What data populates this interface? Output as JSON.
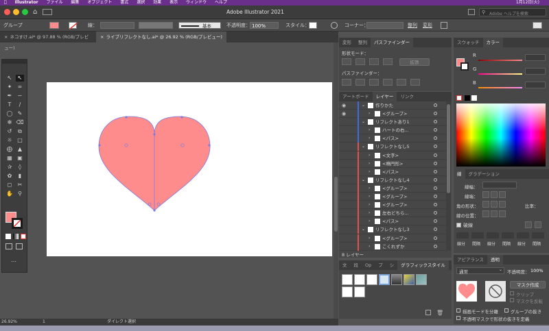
{
  "menubar": {
    "items": [
      "Illustrator",
      "ファイル",
      "編集",
      "オブジェクト",
      "書式",
      "選択",
      "効果",
      "表示",
      "ウィンドウ",
      "ヘルプ"
    ],
    "datetime": "1月12日(火)"
  },
  "app": {
    "title": "Adobe Illustrator 2021",
    "search_placeholder": "Adobe ヘルプを検索"
  },
  "control_bar": {
    "selection_label": "グループ",
    "stroke_label": "線：",
    "stroke_style": "基本",
    "opacity_label": "不透明度：",
    "opacity_value": "100%",
    "style_label": "スタイル：",
    "corner_label": "コーナー：",
    "align_label": "整列",
    "transform_label": "変形"
  },
  "doc_tabs": [
    {
      "label": "ネコすけ.ai* @ 97.88 % (RGB/プレビュー)",
      "active": false
    },
    {
      "label": "ライブリフレクトなし.ai* @ 26.92 % (RGB/プレビュー)",
      "active": true
    }
  ],
  "colors": {
    "heart_fill": "#FF8C8C",
    "path_stroke": "#7B79E0",
    "menubar": "#6a2f8a",
    "accent_blue": "#1f6fd0"
  },
  "pathfinder": {
    "tabs": [
      "変形",
      "整列",
      "パスファインダー"
    ],
    "shape_modes_label": "形状モード：",
    "expand_label": "拡張",
    "pathfinders_label": "パスファインダー："
  },
  "layers": {
    "tabs": [
      "アートボード",
      "レイヤー",
      "リンク"
    ],
    "rows": [
      {
        "label": "作りかた",
        "level": 0,
        "visible": true
      },
      {
        "label": "<グループ>",
        "level": 1,
        "visible": true
      },
      {
        "label": "リフレクトあり1",
        "level": 0,
        "visible": false
      },
      {
        "label": "ハートの右...",
        "level": 1,
        "visible": false
      },
      {
        "label": "<パス>",
        "level": 1,
        "visible": false
      },
      {
        "label": "リフレクトなし5",
        "level": 0,
        "visible": false
      },
      {
        "label": "<文字>",
        "level": 1,
        "visible": false
      },
      {
        "label": "<楕円形>",
        "level": 1,
        "visible": false
      },
      {
        "label": "<パス>",
        "level": 1,
        "visible": false
      },
      {
        "label": "リフレクトなし4",
        "level": 0,
        "visible": false
      },
      {
        "label": "<グループ>",
        "level": 1,
        "visible": false
      },
      {
        "label": "<グループ>",
        "level": 1,
        "visible": false
      },
      {
        "label": "<グループ>",
        "level": 1,
        "visible": false
      },
      {
        "label": "左右どちら...",
        "level": 1,
        "visible": false
      },
      {
        "label": "<パス>",
        "level": 1,
        "visible": false
      },
      {
        "label": "リフレクトなし3",
        "level": 0,
        "visible": false
      },
      {
        "label": "<グループ>",
        "level": 1,
        "visible": false
      },
      {
        "label": "こくれずか",
        "level": 1,
        "visible": false
      }
    ],
    "count_label": "8 レイヤー"
  },
  "graphic_styles": {
    "tabs": [
      "文",
      "段",
      "Op",
      "プ",
      "シ",
      "グラフィックスタイル"
    ]
  },
  "swatches": {
    "tabs": [
      "スウォッチ",
      "カラー"
    ],
    "channels": [
      "R",
      "G",
      "B"
    ]
  },
  "stroke_panel": {
    "tabs": [
      "線",
      "グラデーション"
    ],
    "width_label": "線幅：",
    "cap_label": "線端：",
    "corner_label": "角の形状：",
    "limit_label": "比率：",
    "align_label": "線の位置：",
    "dashed_label": "破線",
    "dash_cells": [
      "線分",
      "間隔",
      "線分",
      "間隔",
      "線分",
      "間隔"
    ]
  },
  "transparency": {
    "tabs": [
      "アピアランス",
      "透明"
    ],
    "blend_mode": "通常",
    "opacity_label": "不透明度：",
    "opacity_value": "100%",
    "mask_button": "マスク作成",
    "clip_label": "クリップ",
    "invert_label": "マスクを反転",
    "isolate_label": "描画モードを分離",
    "knockout_label": "グループの抜き",
    "opacity_mask_label": "不透明マスクで形状の抜きを定義"
  },
  "status": {
    "zoom": "26.92%",
    "page": "1",
    "tool": "ダイレクト選択"
  }
}
